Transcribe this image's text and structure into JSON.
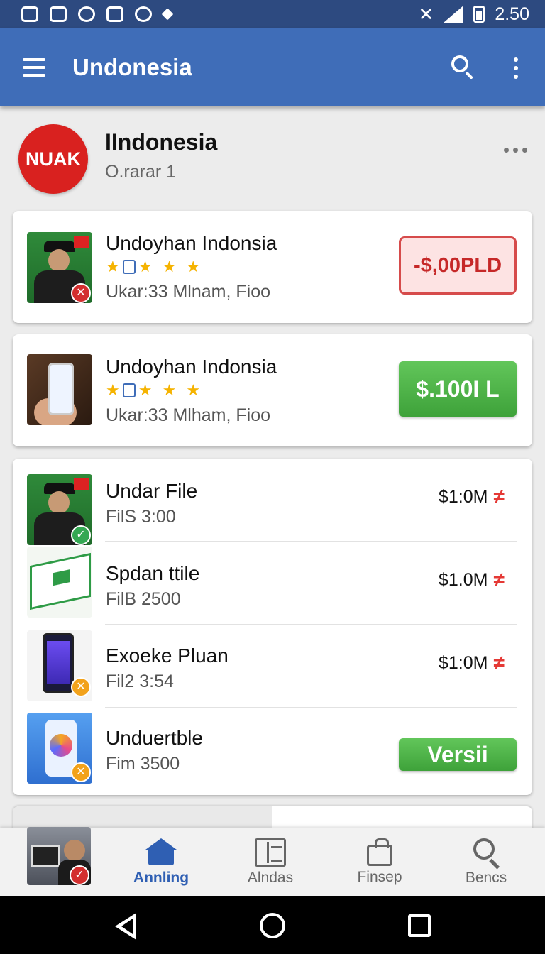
{
  "status_bar": {
    "time": "2.50"
  },
  "app_bar": {
    "title": "Undonesia",
    "icons": [
      "menu-icon",
      "search-icon",
      "more-vert-icon"
    ]
  },
  "profile": {
    "logo_text": "NUAK",
    "name": "IIndonesia",
    "subtitle": "O.rarar 1"
  },
  "featured": [
    {
      "title": "Undoyhan Indonsia",
      "rating": 4,
      "subtitle": "Ukar:33 Mlnam, Fioo",
      "action_label": "-$,00PLD",
      "action_style": "red-outline"
    },
    {
      "title": "Undoyhan Indonsia",
      "rating": 4,
      "subtitle": "Ukar:33 Mlham, Fioo",
      "action_label": "$.100I L",
      "action_style": "green"
    }
  ],
  "files": [
    {
      "title": "Undar File",
      "subtitle": "FilS 3:00",
      "price": "$1:0M",
      "badge": "green"
    },
    {
      "title": "Spdan ttile",
      "subtitle": "FilB 2500",
      "price": "$1.0M",
      "badge": "none"
    },
    {
      "title": "Exoeke Pluan",
      "subtitle": "Fil2 3:54",
      "price": "$1:0M",
      "badge": "orange"
    },
    {
      "title": "Unduertble",
      "subtitle": "Fim 3500",
      "action_label": "Versii",
      "badge": "orange"
    }
  ],
  "bottom_nav": [
    {
      "label": "Annling",
      "icon": "home-icon",
      "active": true
    },
    {
      "label": "Alndas",
      "icon": "grid-icon",
      "active": false
    },
    {
      "label": "Finsep",
      "icon": "bag-icon",
      "active": false
    },
    {
      "label": "Bencs",
      "icon": "search-icon",
      "active": false
    }
  ],
  "colors": {
    "status_bar": "#2d4a80",
    "app_bar": "#3f6db8",
    "accent_blue": "#2f5fb3",
    "red": "#d32f2f",
    "green": "#4cb548",
    "star": "#f5b301"
  }
}
